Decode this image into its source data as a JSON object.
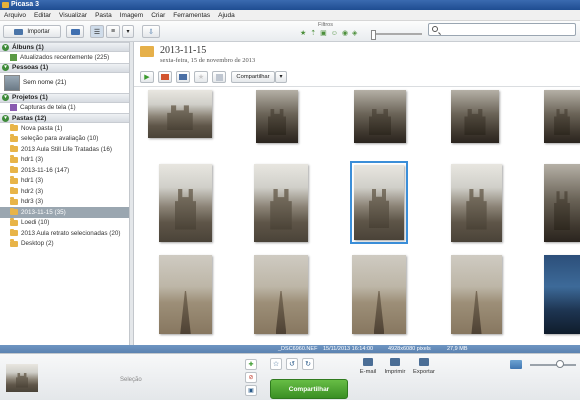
{
  "window": {
    "title": "Picasa 3"
  },
  "menu": [
    "Arquivo",
    "Editar",
    "Visualizar",
    "Pasta",
    "Imagem",
    "Criar",
    "Ferramentas",
    "Ajuda"
  ],
  "toolbar": {
    "import_label": "Importar",
    "filters_label": "Filtros"
  },
  "sidebar": {
    "albums": {
      "header": "Álbuns (1)",
      "items": [
        "Atualizados recentemente (225)"
      ]
    },
    "people": {
      "header": "Pessoas (1)",
      "items": [
        "Sem nome (21)"
      ]
    },
    "projects": {
      "header": "Projetos (1)",
      "items": [
        "Capturas de tela (1)"
      ]
    },
    "folders": {
      "header": "Pastas (12)",
      "items": [
        "Nova pasta (1)",
        "seleção  para avaliação (10)",
        "2013 Aula Still Life Tratadas (16)",
        "hdr1 (3)",
        "2013-11-16 (147)",
        "hdr1 (3)",
        "hdr2 (3)",
        "hdr3 (3)",
        "2013-11-15 (35)",
        "Loedi (10)",
        "2013 Aula retrato selecionadas (20)",
        "Desktop (2)"
      ],
      "selected_index": 8
    }
  },
  "content": {
    "folder_title": "2013-11-15",
    "folder_date": "sexta-feira, 15 de novembro de 2013",
    "share_label": "Compartilhar"
  },
  "status": {
    "filename": "_DSC6960.NEF",
    "datetime": "15/11/2013 16:14:00",
    "dimensions": "4928x6080 pixels",
    "size": "27,9 MB"
  },
  "bottom": {
    "tray_label": "Seleção",
    "share_button": "Compartilhar",
    "actions": [
      "E-mail",
      "Imprimir",
      "Exportar"
    ]
  }
}
